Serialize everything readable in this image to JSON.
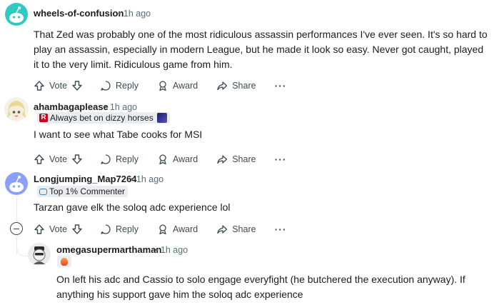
{
  "comments": [
    {
      "username": "wheels-of-confusion",
      "time": "1h ago",
      "body": "That Zed was probably one of the most ridiculous assassin performances I've ever seen. It's so hard to play an assassin, especially in modern League, but he made it look so easy. Never got caught, played it to the very limit. Ridiculous game from him.",
      "avatar_icon": "snoo-avatar-teal"
    },
    {
      "username": "ahambagaplease",
      "time": "1h ago",
      "flair": "Always bet on dizzy horses",
      "body": "I want to see what Tabe cooks for MSI",
      "avatar_icon": "anime-avatar"
    },
    {
      "username": "Longjumping_Map7264",
      "time": "1h ago",
      "flair": "Top 1% Commenter",
      "body": "Tarzan gave elk the soloq adc experience lol",
      "avatar_icon": "snoo-avatar-blue"
    },
    {
      "username": "omegasupermarthaman",
      "time": "1h ago",
      "body": "On left his adc and Cassio to solo engage everyfight (he butchered the execution anyway). If anything his support gave him the soloq adc experience",
      "avatar_icon": "custom-avatar"
    }
  ],
  "actions": {
    "vote": "Vote",
    "reply": "Reply",
    "award": "Award",
    "share": "Share",
    "more": "···"
  },
  "separator": "•",
  "colors": {
    "teal_avatar": "#33c9c3",
    "blue_avatar": "#8aa0ff",
    "muted_text": "#576f76",
    "flair_bg": "#eaedef",
    "thread_line": "#e5ebee"
  }
}
